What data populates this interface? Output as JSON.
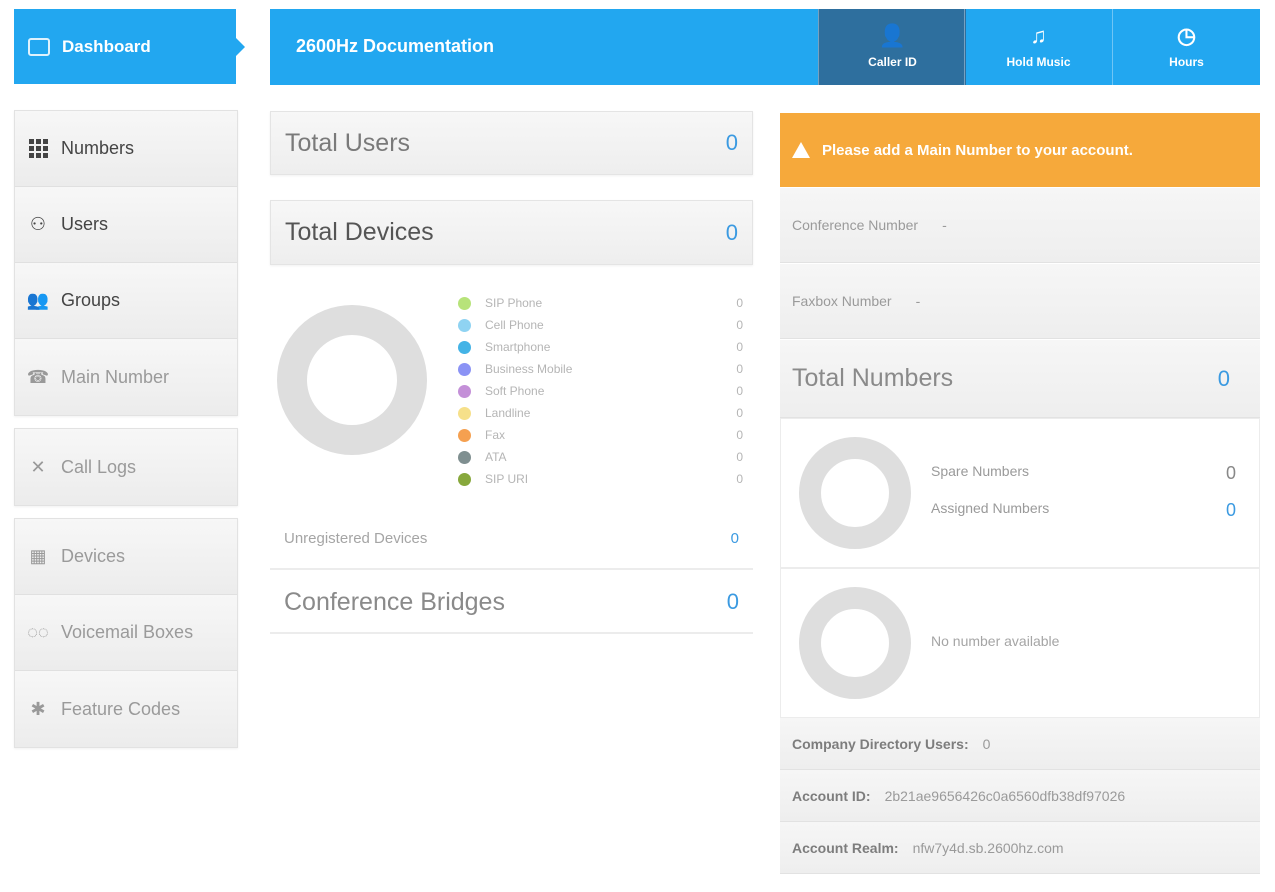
{
  "sidebar": {
    "dashboard_label": "Dashboard",
    "items": [
      {
        "label": "Numbers",
        "icon": "grid-icon"
      },
      {
        "label": "Users",
        "icon": "users-icon"
      },
      {
        "label": "Groups",
        "icon": "groups-icon"
      },
      {
        "label": "Main Number",
        "icon": "main-number-icon"
      },
      {
        "label": "Call Logs",
        "icon": "call-logs-icon"
      },
      {
        "label": "Devices",
        "icon": "devices-icon"
      },
      {
        "label": "Voicemail Boxes",
        "icon": "voicemail-icon"
      },
      {
        "label": "Feature Codes",
        "icon": "feature-codes-icon"
      }
    ]
  },
  "topbar": {
    "title": "2600Hz Documentation",
    "buttons": [
      {
        "label": "Caller ID",
        "icon": "person-icon"
      },
      {
        "label": "Hold Music",
        "icon": "music-icon"
      },
      {
        "label": "Hours",
        "icon": "clock-icon"
      }
    ]
  },
  "center": {
    "total_users": {
      "label": "Total Users",
      "value": "0"
    },
    "total_devices": {
      "label": "Total Devices",
      "value": "0"
    },
    "device_legend": [
      {
        "name": "SIP Phone",
        "value": "0",
        "color": "#b7e37a"
      },
      {
        "name": "Cell Phone",
        "value": "0",
        "color": "#8fd3f2"
      },
      {
        "name": "Smartphone",
        "value": "0",
        "color": "#44b3e6"
      },
      {
        "name": "Business Mobile",
        "value": "0",
        "color": "#8b93f5"
      },
      {
        "name": "Soft Phone",
        "value": "0",
        "color": "#c490d8"
      },
      {
        "name": "Landline",
        "value": "0",
        "color": "#f6e08a"
      },
      {
        "name": "Fax",
        "value": "0",
        "color": "#f5a050"
      },
      {
        "name": "ATA",
        "value": "0",
        "color": "#7f8f90"
      },
      {
        "name": "SIP URI",
        "value": "0",
        "color": "#87a83c"
      }
    ],
    "unregistered": {
      "label": "Unregistered Devices",
      "value": "0"
    },
    "conference_bridges": {
      "label": "Conference Bridges",
      "value": "0"
    }
  },
  "right": {
    "alert": "Please add a Main Number to your account.",
    "conference_number": {
      "label": "Conference Number",
      "value": "-"
    },
    "faxbox_number": {
      "label": "Faxbox Number",
      "value": "-"
    },
    "total_numbers": {
      "label": "Total Numbers",
      "value": "0"
    },
    "spare_numbers": {
      "label": "Spare Numbers",
      "value": "0"
    },
    "assigned_numbers": {
      "label": "Assigned Numbers",
      "value": "0"
    },
    "no_number": "No number available",
    "company_directory": {
      "label": "Company Directory Users:",
      "value": "0"
    },
    "account_id": {
      "label": "Account ID:",
      "value": "2b21ae9656426c0a6560dfb38df97026"
    },
    "account_realm": {
      "label": "Account Realm:",
      "value": "nfw7y4d.sb.2600hz.com"
    }
  },
  "colors": {
    "accent": "#22a7f0",
    "active_tab": "#2e6f9e",
    "alert": "#f6a93b",
    "value_blue": "#3b9ae1"
  }
}
